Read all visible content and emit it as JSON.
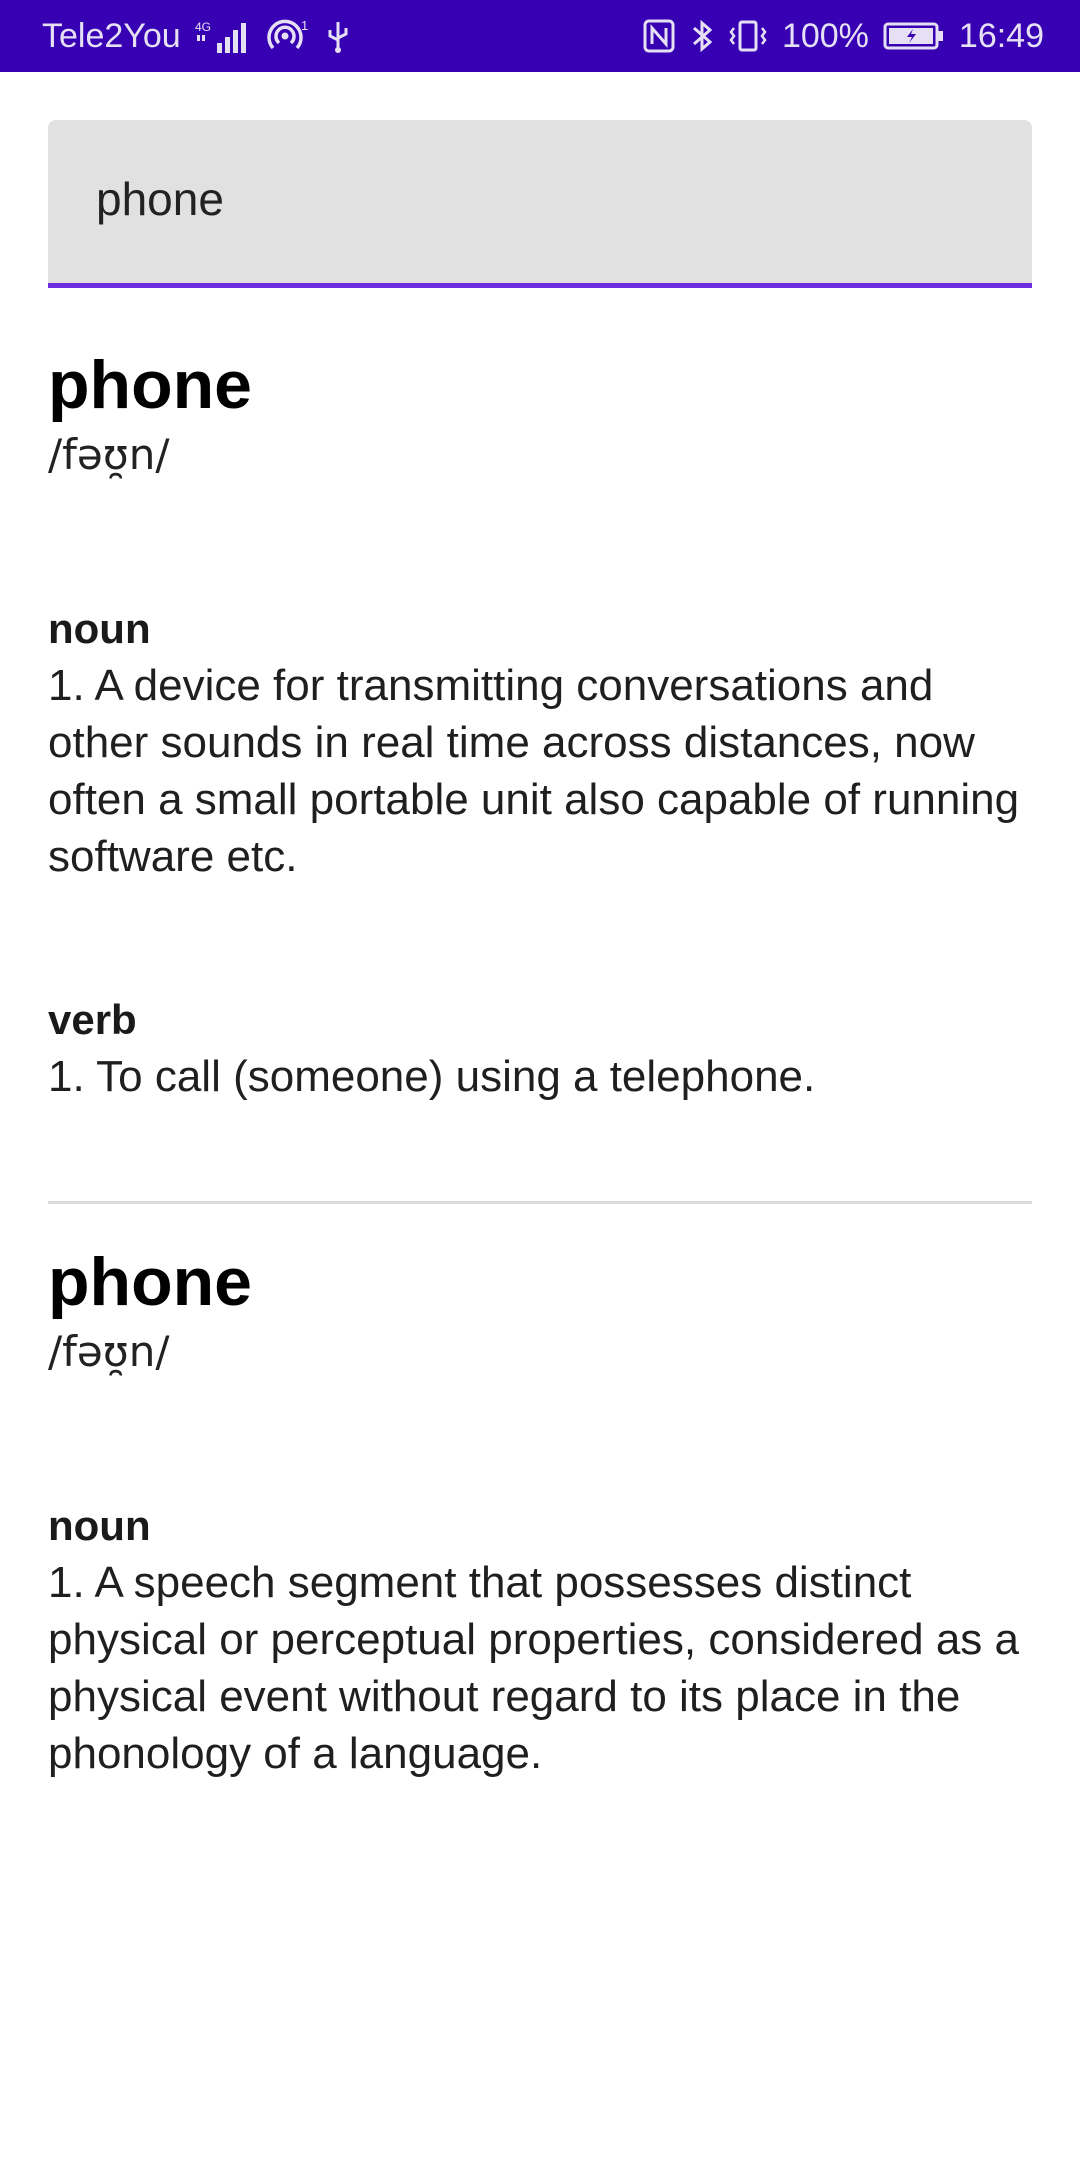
{
  "status_bar": {
    "carrier": "Tele2You",
    "network_type": "4G",
    "battery": "100%",
    "time": "16:49",
    "icons": [
      "signal-icon",
      "hotspot-icon",
      "usb-icon",
      "nfc-icon",
      "bluetooth-icon",
      "vibrate-icon",
      "battery-icon"
    ]
  },
  "search": {
    "value": "phone",
    "underline_color": "#6d2ee0"
  },
  "entries": [
    {
      "word": "phone",
      "phonetic": "/fəʊ̯n/",
      "meanings": [
        {
          "part_of_speech": "noun",
          "definition": "1. A device for transmitting conversations and other sounds in real time across distances, now often a small portable unit also capable of running software etc."
        },
        {
          "part_of_speech": "verb",
          "definition": "1. To call (someone) using a telephone."
        }
      ]
    },
    {
      "word": "phone",
      "phonetic": "/fəʊ̯n/",
      "meanings": [
        {
          "part_of_speech": "noun",
          "definition": "1. A speech segment that possesses distinct physical or perceptual properties, considered as a physical event without regard to its place in the phonology of a language."
        }
      ]
    }
  ],
  "colors": {
    "status_bar": "#3700B3",
    "accent": "#6d2ee0",
    "search_background": "#e1e1e1"
  }
}
